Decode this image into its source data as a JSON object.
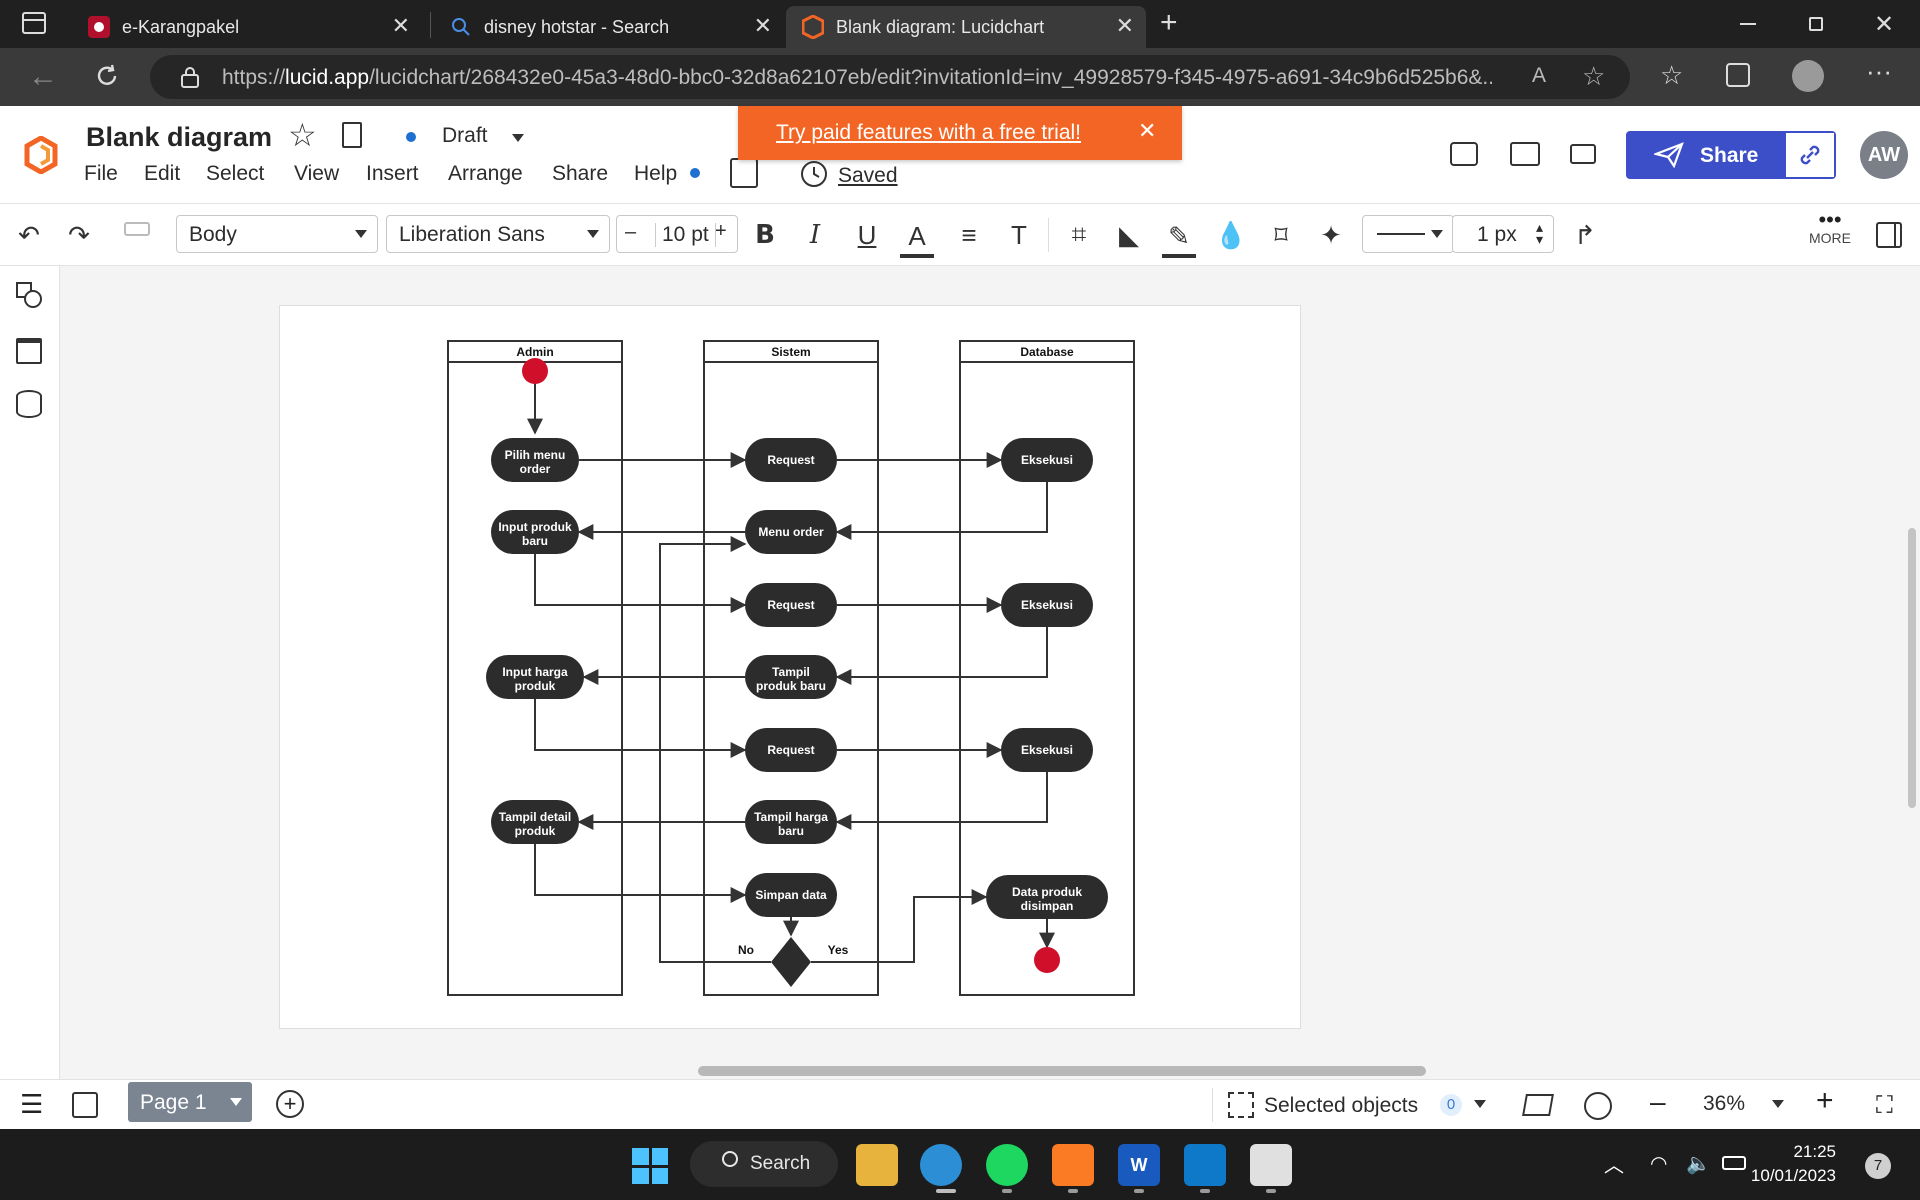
{
  "browser": {
    "tabs": [
      {
        "title": "e-Karangpakel",
        "icon": "record-icon"
      },
      {
        "title": "disney hotstar - Search",
        "icon": "search-icon"
      },
      {
        "title": "Blank diagram: Lucidchart",
        "icon": "lucid-logo-icon",
        "active": true
      }
    ],
    "url_prefix": "https://",
    "url_host": "lucid.app",
    "url_path": "/lucidchart/268432e0-45a3-48d0-bbc0-32d8a62107eb/edit?invitationId=inv_49928579-f345-4975-a691-34c9b6d525b6&..."
  },
  "app": {
    "doc_title": "Blank diagram",
    "menus": [
      "File",
      "Edit",
      "Select",
      "View",
      "Insert",
      "Arrange",
      "Share",
      "Help"
    ],
    "status": "Draft",
    "saved": "Saved",
    "trial_banner": "Try paid features with a free trial!",
    "share_label": "Share",
    "avatar_initials": "AW",
    "accent": "#3d4fc8",
    "banner_color": "#f26524"
  },
  "toolbar": {
    "style": "Body",
    "font": "Liberation Sans",
    "font_size": "10 pt",
    "line_width": "1 px",
    "more_label": "MORE"
  },
  "bottom": {
    "page_tab": "Page 1",
    "selected_label": "Selected objects",
    "selected_count": "0",
    "zoom": "36%"
  },
  "taskbar": {
    "search_label": "Search",
    "time": "21:25",
    "date": "10/01/2023",
    "notifications": "7"
  },
  "diagram": {
    "lanes": [
      "Admin",
      "Sistem",
      "Database"
    ],
    "nodes": {
      "n_pilih": "Pilih menu|order",
      "n_input_produk": "Input produk|baru",
      "n_input_harga": "Input harga|produk",
      "n_tampil_detail": "Tampil detail|produk",
      "n_req1": "Request",
      "n_menu_order": "Menu order",
      "n_req2": "Request",
      "n_tampil_produk": "Tampil|produk baru",
      "n_req3": "Request",
      "n_tampil_harga": "Tampil harga|baru",
      "n_simpan": "Simpan data",
      "n_eks1": "Eksekusi",
      "n_eks2": "Eksekusi",
      "n_eks3": "Eksekusi",
      "n_data_disimpan": "Data produk|disimpan"
    },
    "labels": {
      "no": "No",
      "yes": "Yes"
    }
  }
}
